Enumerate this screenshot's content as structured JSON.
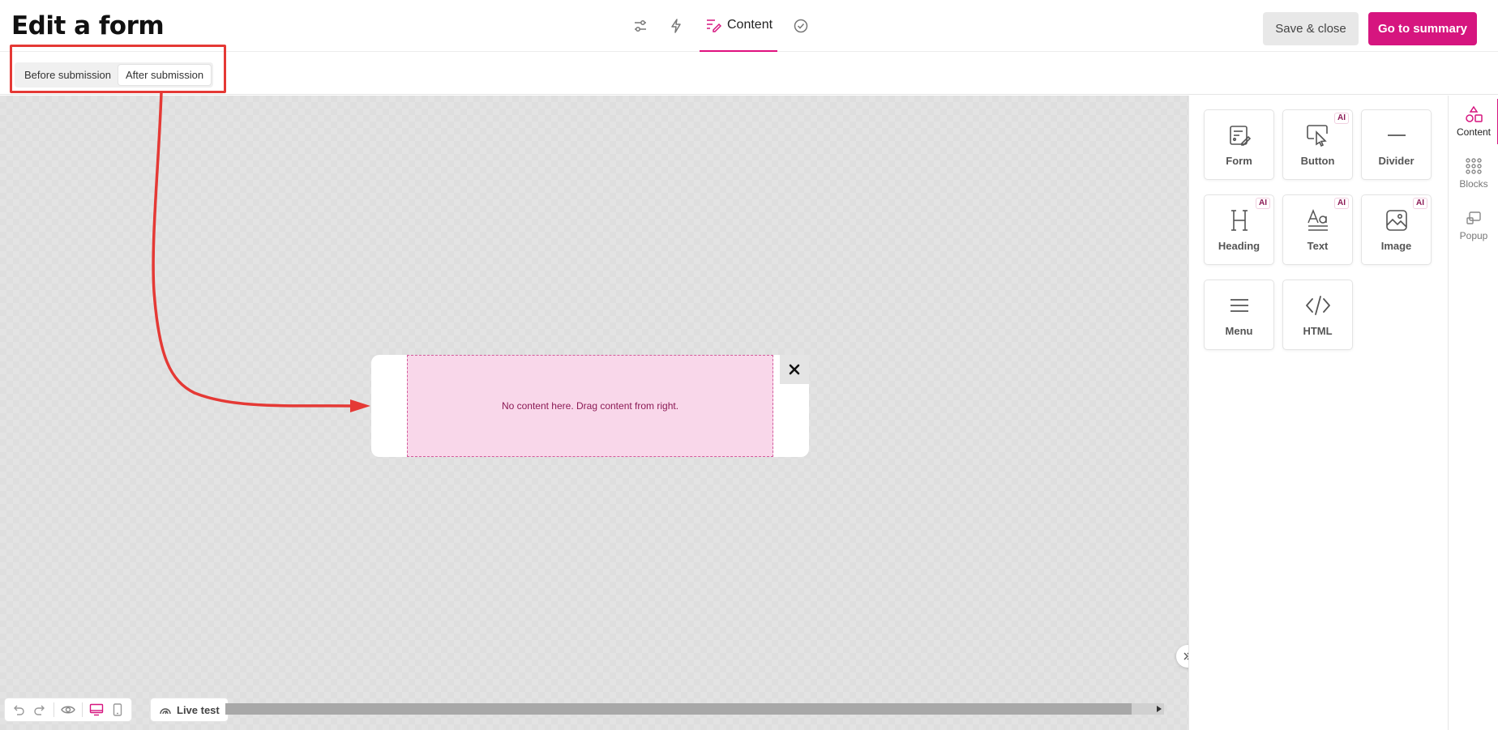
{
  "header": {
    "title": "Edit a form",
    "steps": [
      {
        "icon": "sliders-icon"
      },
      {
        "icon": "lightning-icon"
      },
      {
        "icon": "content-edit-icon",
        "label": "Content",
        "active": true
      },
      {
        "icon": "check-circle-icon"
      }
    ],
    "save_close_label": "Save & close",
    "go_summary_label": "Go to summary"
  },
  "submission_toggle": {
    "options": [
      "Before submission",
      "After submission"
    ],
    "selected": "After submission"
  },
  "canvas": {
    "empty_message": "No content here. Drag content from right.",
    "close_symbol": "✕"
  },
  "bottom_toolbar": {
    "tools": [
      "undo-icon",
      "redo-icon",
      "preview-eye-icon",
      "desktop-icon",
      "mobile-icon"
    ],
    "active_view": "desktop",
    "live_test_label": "Live test"
  },
  "content_panel": {
    "tiles": [
      {
        "label": "Form",
        "icon": "form-icon",
        "ai": false
      },
      {
        "label": "Button",
        "icon": "button-cursor-icon",
        "ai": true
      },
      {
        "label": "Divider",
        "icon": "divider-icon",
        "ai": false
      },
      {
        "label": "Heading",
        "icon": "heading-icon",
        "ai": true
      },
      {
        "label": "Text",
        "icon": "text-icon",
        "ai": true
      },
      {
        "label": "Image",
        "icon": "image-icon",
        "ai": true
      },
      {
        "label": "Menu",
        "icon": "menu-icon",
        "ai": false
      },
      {
        "label": "HTML",
        "icon": "code-icon",
        "ai": false
      }
    ],
    "ai_badge": "AI"
  },
  "rail": {
    "items": [
      {
        "label": "Content",
        "icon": "shapes-icon",
        "active": true
      },
      {
        "label": "Blocks",
        "icon": "grid-dots-icon",
        "active": false
      },
      {
        "label": "Popup",
        "icon": "popup-icon",
        "active": false
      }
    ]
  },
  "colors": {
    "accent": "#d6157f",
    "annotation": "#e53935",
    "dropzone": "#f9d7ea"
  }
}
